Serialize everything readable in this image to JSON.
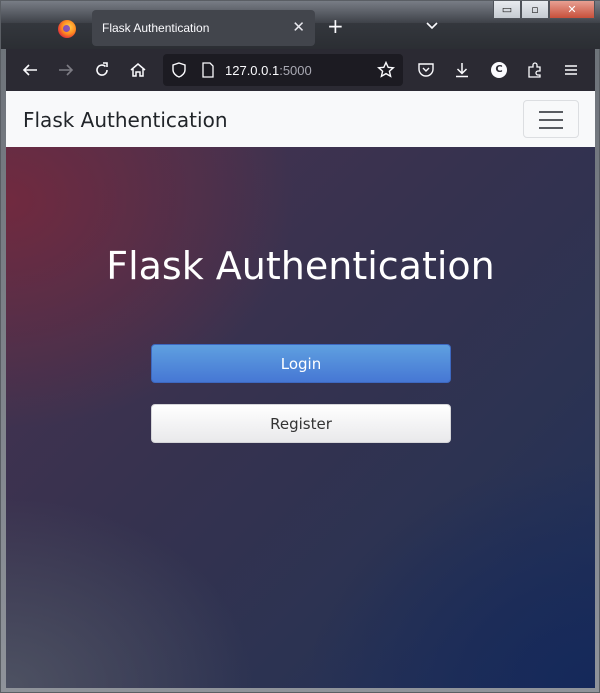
{
  "browser": {
    "tab_title": "Flask Authentication",
    "tab_close": "✕",
    "new_tab": "+",
    "url_host": "127.0.0.1",
    "url_port": ":5000",
    "profile_initial": "C",
    "window_controls": {
      "minimize": "▭",
      "maximize": "▫",
      "close": "✕"
    }
  },
  "site": {
    "brand": "Flask Authentication",
    "hero_title": "Flask Authentication",
    "login_label": "Login",
    "register_label": "Register"
  },
  "colors": {
    "login_button": "#4a7bd6",
    "navbar_bg": "#f8f9fa",
    "browser_chrome": "#2b2a33"
  }
}
